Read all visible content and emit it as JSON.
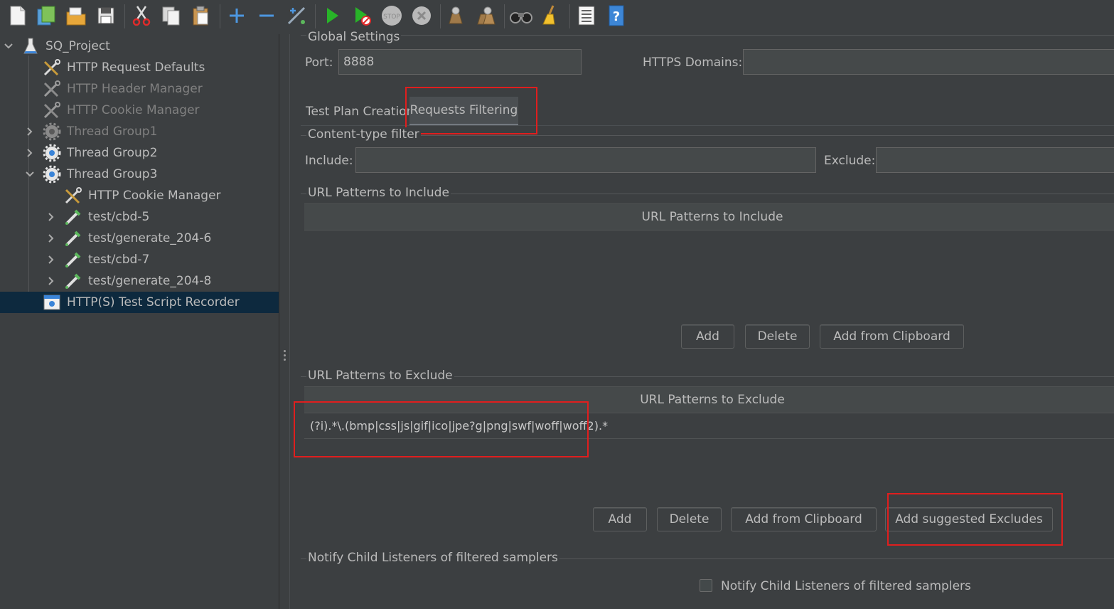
{
  "toolbar": {
    "icons": [
      "new-icon",
      "templates-icon",
      "open-icon",
      "save-icon",
      "cut-icon",
      "copy-icon",
      "paste-icon",
      "expand-icon",
      "collapse-icon",
      "toggle-icon",
      "start-icon",
      "start-no-pauses-icon",
      "stop-icon",
      "shutdown-icon",
      "clear-icon",
      "clear-all-icon",
      "search-icon",
      "reset-search-icon",
      "function-helper-icon",
      "help-icon"
    ]
  },
  "tree": {
    "nodes": [
      {
        "label": "SQ_Project",
        "icon": "test-plan-icon"
      },
      {
        "label": "HTTP Request Defaults",
        "icon": "config-tools-icon"
      },
      {
        "label": "HTTP Header Manager",
        "icon": "config-tools-icon"
      },
      {
        "label": "HTTP Cookie Manager",
        "icon": "config-tools-icon"
      },
      {
        "label": "Thread Group1",
        "icon": "gear-icon"
      },
      {
        "label": "Thread Group2",
        "icon": "gear-icon"
      },
      {
        "label": "Thread Group3",
        "icon": "gear-icon"
      },
      {
        "label": "HTTP Cookie Manager",
        "icon": "config-tools-icon"
      },
      {
        "label": "test/cbd-5",
        "icon": "pipette-icon"
      },
      {
        "label": "test/generate_204-6",
        "icon": "pipette-icon"
      },
      {
        "label": "test/cbd-7",
        "icon": "pipette-icon"
      },
      {
        "label": "test/generate_204-8",
        "icon": "pipette-icon"
      },
      {
        "label": "HTTP(S) Test Script Recorder",
        "icon": "recorder-icon"
      }
    ]
  },
  "global": {
    "title": "Global Settings",
    "port_label": "Port:",
    "port_value": "8888",
    "https_label": "HTTPS Domains:",
    "https_value": ""
  },
  "tabs": [
    "Test Plan Creation",
    "Requests Filtering"
  ],
  "content_type": {
    "title": "Content-type filter",
    "include_label": "Include:",
    "include_value": "",
    "exclude_label": "Exclude:",
    "exclude_value": ""
  },
  "include_patterns": {
    "title": "URL Patterns to Include",
    "header": "URL Patterns to Include",
    "buttons": [
      "Add",
      "Delete",
      "Add from Clipboard"
    ]
  },
  "exclude_patterns": {
    "title": "URL Patterns to Exclude",
    "header": "URL Patterns to Exclude",
    "rows": [
      "(?i).*\\.(bmp|css|js|gif|ico|jpe?g|png|swf|woff|woff2).*"
    ],
    "buttons": [
      "Add",
      "Delete",
      "Add from Clipboard",
      "Add suggested Excludes"
    ]
  },
  "notify": {
    "title": "Notify Child Listeners of filtered samplers",
    "checkbox_label": "Notify Child Listeners of filtered samplers",
    "checked": false
  }
}
